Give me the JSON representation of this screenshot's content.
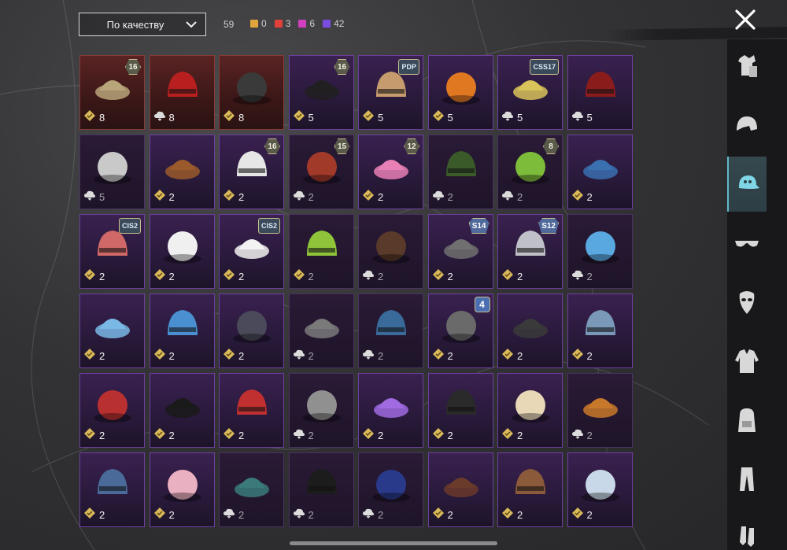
{
  "toolbar": {
    "sort_label": "По качеству",
    "total": "59",
    "stats": [
      {
        "value": "0",
        "color": "#e0a53a",
        "name": "gold"
      },
      {
        "value": "3",
        "color": "#e0413c",
        "name": "red"
      },
      {
        "value": "6",
        "color": "#cf3fbf",
        "name": "pink"
      },
      {
        "value": "42",
        "color": "#7a4de0",
        "name": "purple"
      }
    ]
  },
  "items": [
    {
      "count": "8",
      "badge": "16",
      "badge_type": "hex",
      "tier": "red",
      "currency": "gold",
      "icon": "helmet-goggles-icon",
      "color": "#b8a57a"
    },
    {
      "count": "8",
      "badge": "",
      "badge_type": "",
      "tier": "red",
      "currency": "cloud",
      "icon": "helmet-red-icon",
      "color": "#b82020"
    },
    {
      "count": "8",
      "badge": "",
      "badge_type": "",
      "tier": "red",
      "currency": "gold",
      "icon": "helmet-visor-icon",
      "color": "#3a3a3a"
    },
    {
      "count": "5",
      "badge": "16",
      "badge_type": "hex",
      "tier": "purple",
      "currency": "gold",
      "icon": "hood-icon",
      "color": "#202020"
    },
    {
      "count": "5",
      "badge": "PDP",
      "badge_type": "ss",
      "tier": "purple",
      "currency": "gold",
      "icon": "animal-mask-icon",
      "color": "#c69b6e"
    },
    {
      "count": "5",
      "badge": "",
      "badge_type": "",
      "tier": "purple",
      "currency": "gold",
      "icon": "pumpkin-icon",
      "color": "#e07822"
    },
    {
      "count": "5",
      "badge": "CSS17",
      "badge_type": "ss",
      "tier": "purple",
      "currency": "cloud",
      "icon": "visor-hair-icon",
      "color": "#d8c25a"
    },
    {
      "count": "5",
      "badge": "",
      "badge_type": "",
      "tier": "purple",
      "currency": "cloud",
      "icon": "red-mask-icon",
      "color": "#8a1c1c"
    },
    {
      "count": "5",
      "badge": "",
      "badge_type": "",
      "tier": "dim",
      "currency": "cloud",
      "icon": "pith-helmet-icon",
      "color": "#c9c9c9"
    },
    {
      "count": "2",
      "badge": "",
      "badge_type": "",
      "tier": "purple",
      "currency": "gold",
      "icon": "horse-mask-icon",
      "color": "#9a5a2c"
    },
    {
      "count": "2",
      "badge": "16",
      "badge_type": "hex",
      "tier": "purple",
      "currency": "gold",
      "icon": "spiky-helmet-icon",
      "color": "#e6e6e6"
    },
    {
      "count": "2",
      "badge": "15",
      "badge_type": "hex",
      "tier": "dim",
      "currency": "cloud",
      "icon": "red-hair-icon",
      "color": "#a23a2a"
    },
    {
      "count": "2",
      "badge": "12",
      "badge_type": "hex",
      "tier": "purple",
      "currency": "gold",
      "icon": "bunny-ears-icon",
      "color": "#e87fb5"
    },
    {
      "count": "2",
      "badge": "",
      "badge_type": "",
      "tier": "dim",
      "currency": "cloud",
      "icon": "officer-cap-icon",
      "color": "#3a5a2a"
    },
    {
      "count": "2",
      "badge": "8",
      "badge_type": "hex",
      "tier": "dim",
      "currency": "cloud",
      "icon": "green-skull-icon",
      "color": "#7dbb3a"
    },
    {
      "count": "2",
      "badge": "",
      "badge_type": "",
      "tier": "purple",
      "currency": "gold",
      "icon": "baseball-cap-icon",
      "color": "#3a6fb0"
    },
    {
      "count": "2",
      "badge": "CIS2",
      "badge_type": "ss",
      "tier": "purple",
      "currency": "gold",
      "icon": "beanie-striped-icon",
      "color": "#d06868"
    },
    {
      "count": "2",
      "badge": "",
      "badge_type": "",
      "tier": "purple",
      "currency": "gold",
      "icon": "sun-hat-icon",
      "color": "#f0f0f0"
    },
    {
      "count": "2",
      "badge": "CIS2",
      "badge_type": "ss",
      "tier": "purple",
      "currency": "gold",
      "icon": "chef-hat-icon",
      "color": "#f2f2f2"
    },
    {
      "count": "2",
      "badge": "",
      "badge_type": "",
      "tier": "dim",
      "currency": "gold",
      "icon": "green-cap-icon",
      "color": "#8fc43a"
    },
    {
      "count": "2",
      "badge": "",
      "badge_type": "",
      "tier": "dim",
      "currency": "cloud",
      "icon": "steampunk-hat-icon",
      "color": "#5a3a2a"
    },
    {
      "count": "2",
      "badge": "S14",
      "badge_type": "wing",
      "tier": "purple",
      "currency": "gold",
      "icon": "knight-helmet-icon",
      "color": "#707070"
    },
    {
      "count": "2",
      "badge": "S12",
      "badge_type": "wing",
      "tier": "purple",
      "currency": "gold",
      "icon": "space-helmet-icon",
      "color": "#c0c0c8"
    },
    {
      "count": "2",
      "badge": "",
      "badge_type": "",
      "tier": "dim",
      "currency": "cloud",
      "icon": "blue-ears-icon",
      "color": "#5aa8e0"
    },
    {
      "count": "2",
      "badge": "",
      "badge_type": "",
      "tier": "purple",
      "currency": "gold",
      "icon": "blue-beret-icon",
      "color": "#7ab8e6"
    },
    {
      "count": "2",
      "badge": "",
      "badge_type": "",
      "tier": "purple",
      "currency": "gold",
      "icon": "ski-hat-icon",
      "color": "#4a90d0"
    },
    {
      "count": "2",
      "badge": "",
      "badge_type": "",
      "tier": "purple",
      "currency": "gold",
      "icon": "knit-beanie-icon",
      "color": "#4a4a5a"
    },
    {
      "count": "2",
      "badge": "",
      "badge_type": "",
      "tier": "dim",
      "currency": "cloud",
      "icon": "grey-beanie-icon",
      "color": "#7a7a7a"
    },
    {
      "count": "2",
      "badge": "",
      "badge_type": "",
      "tier": "dim",
      "currency": "cloud",
      "icon": "turban-icon",
      "color": "#3a6a9a"
    },
    {
      "count": "2",
      "badge": "4",
      "badge_type": "season",
      "tier": "purple",
      "currency": "gold",
      "icon": "ushanka-icon",
      "color": "#6a6a6a"
    },
    {
      "count": "2",
      "badge": "",
      "badge_type": "",
      "tier": "purple",
      "currency": "gold",
      "icon": "black-mask-icon",
      "color": "#3a3a3a"
    },
    {
      "count": "2",
      "badge": "",
      "badge_type": "",
      "tier": "purple",
      "currency": "gold",
      "icon": "shark-hat-icon",
      "color": "#7a98b8"
    },
    {
      "count": "2",
      "badge": "",
      "badge_type": "",
      "tier": "purple",
      "currency": "gold",
      "icon": "red-beret-icon",
      "color": "#b83030"
    },
    {
      "count": "2",
      "badge": "",
      "badge_type": "",
      "tier": "purple",
      "currency": "gold",
      "icon": "top-hat-icon",
      "color": "#1a1a1a"
    },
    {
      "count": "2",
      "badge": "",
      "badge_type": "",
      "tier": "purple",
      "currency": "gold",
      "icon": "red-fedora-icon",
      "color": "#c03030"
    },
    {
      "count": "2",
      "badge": "",
      "badge_type": "",
      "tier": "dim",
      "currency": "cloud",
      "icon": "grey-shark-hat-icon",
      "color": "#909090"
    },
    {
      "count": "2",
      "badge": "",
      "badge_type": "",
      "tier": "purple",
      "currency": "gold",
      "icon": "flower-crown-icon",
      "color": "#a06ae0"
    },
    {
      "count": "2",
      "badge": "",
      "badge_type": "",
      "tier": "purple",
      "currency": "gold",
      "icon": "gas-mask-helmet-icon",
      "color": "#2a2a2a"
    },
    {
      "count": "2",
      "badge": "",
      "badge_type": "",
      "tier": "purple",
      "currency": "gold",
      "icon": "cake-hat-icon",
      "color": "#e8d8b8"
    },
    {
      "count": "2",
      "badge": "",
      "badge_type": "",
      "tier": "dim",
      "currency": "cloud",
      "icon": "burger-hat-icon",
      "color": "#c8782a"
    },
    {
      "count": "2",
      "badge": "",
      "badge_type": "",
      "tier": "purple",
      "currency": "gold",
      "icon": "sailor-cap-icon",
      "color": "#4a6a9a"
    },
    {
      "count": "2",
      "badge": "",
      "badge_type": "",
      "tier": "purple",
      "currency": "gold",
      "icon": "pink-cap-icon",
      "color": "#e8b0c0"
    },
    {
      "count": "2",
      "badge": "",
      "badge_type": "",
      "tier": "dim",
      "currency": "cloud",
      "icon": "teal-beanie-icon",
      "color": "#3a7a7a"
    },
    {
      "count": "2",
      "badge": "",
      "badge_type": "",
      "tier": "dim",
      "currency": "cloud",
      "icon": "black-cap-icon",
      "color": "#1c1c1c"
    },
    {
      "count": "2",
      "badge": "",
      "badge_type": "",
      "tier": "dim",
      "currency": "cloud",
      "icon": "navy-cap-icon",
      "color": "#2a3a8a"
    },
    {
      "count": "2",
      "badge": "",
      "badge_type": "",
      "tier": "purple",
      "currency": "gold",
      "icon": "brown-fedora-icon",
      "color": "#6a3a2a"
    },
    {
      "count": "2",
      "badge": "",
      "badge_type": "",
      "tier": "purple",
      "currency": "gold",
      "icon": "cowboy-hat-icon",
      "color": "#8a5a3a"
    },
    {
      "count": "2",
      "badge": "",
      "badge_type": "",
      "tier": "purple",
      "currency": "gold",
      "icon": "bandana-icon",
      "color": "#c8d8e8"
    }
  ],
  "sidebar": [
    {
      "name": "sidebar-outfit-icon",
      "active": false
    },
    {
      "name": "sidebar-helmet-icon",
      "active": false
    },
    {
      "name": "sidebar-cap-icon",
      "active": true
    },
    {
      "name": "sidebar-glasses-icon",
      "active": false
    },
    {
      "name": "sidebar-mask-icon",
      "active": false
    },
    {
      "name": "sidebar-jacket-icon",
      "active": false
    },
    {
      "name": "sidebar-backpack-icon",
      "active": false
    },
    {
      "name": "sidebar-pants-icon",
      "active": false
    },
    {
      "name": "sidebar-shoes-icon",
      "active": false
    }
  ]
}
